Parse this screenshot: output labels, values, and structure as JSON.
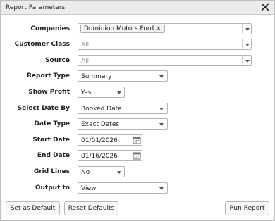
{
  "dialog": {
    "title": "Report Parameters",
    "close_icon": "close-icon"
  },
  "fields": {
    "companies": {
      "label": "Companies",
      "tags": [
        "Dominion Motors Ford"
      ],
      "tag_remove": "×"
    },
    "customer_class": {
      "label": "Customer Class",
      "placeholder": "All"
    },
    "source": {
      "label": "Source",
      "placeholder": "All"
    },
    "report_type": {
      "label": "Report Type",
      "value": "Summary"
    },
    "show_profit": {
      "label": "Show Profit",
      "value": "Yes"
    },
    "select_date_by": {
      "label": "Select Date By",
      "value": "Booked Date"
    },
    "date_type": {
      "label": "Date Type",
      "value": "Exact Dates"
    },
    "start_date": {
      "label": "Start Date",
      "value": "01/01/2026",
      "icon": "calendar-icon"
    },
    "end_date": {
      "label": "End Date",
      "value": "01/16/2026",
      "icon": "calendar-icon"
    },
    "grid_lines": {
      "label": "Grid Lines",
      "value": "No"
    },
    "output_to": {
      "label": "Output to",
      "value": "View"
    }
  },
  "footer": {
    "set_default": "Set as Default",
    "reset_defaults": "Reset Defaults",
    "run_report": "Run Report"
  }
}
